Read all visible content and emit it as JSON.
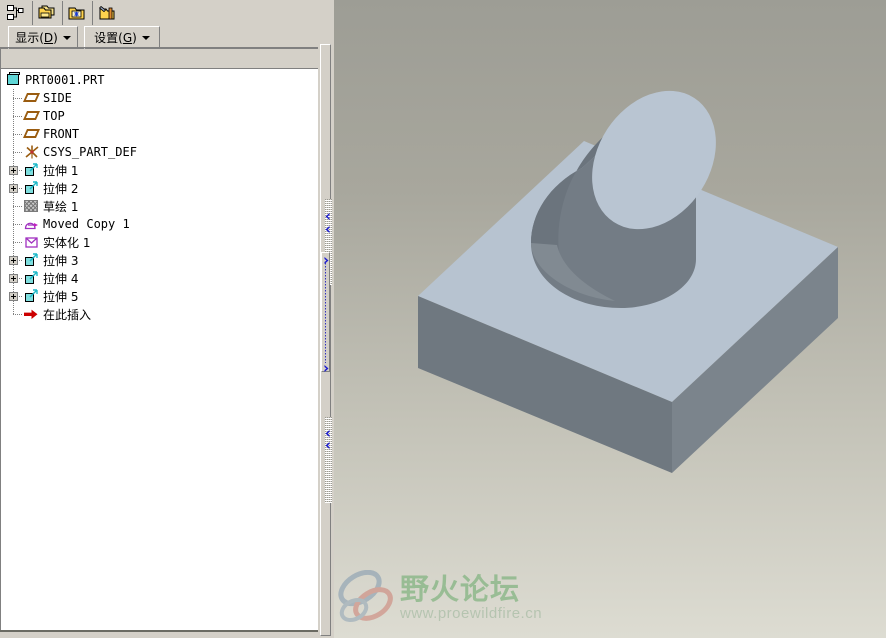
{
  "toolbar": {
    "buttons": [
      {
        "name": "model-tree-icon",
        "tip": "Model Tree"
      },
      {
        "name": "layer-tree-icon",
        "tip": "Layer Tree"
      },
      {
        "name": "new-layer-icon",
        "tip": "New Layer"
      },
      {
        "name": "layer-properties-icon",
        "tip": "Layer Properties"
      }
    ]
  },
  "menubar": {
    "display": {
      "label_pre": "显示(",
      "accel": "D",
      "label_post": ")"
    },
    "settings": {
      "label_pre": "设置(",
      "accel": "G",
      "label_post": ")"
    }
  },
  "tree": {
    "items": [
      {
        "label": "PRT0001.PRT",
        "icon": "part-icon",
        "indent": 0,
        "expander": false,
        "cjk": false
      },
      {
        "label": "SIDE",
        "icon": "datum-plane-icon",
        "indent": 1,
        "expander": false,
        "cjk": false
      },
      {
        "label": "TOP",
        "icon": "datum-plane-icon",
        "indent": 1,
        "expander": false,
        "cjk": false
      },
      {
        "label": "FRONT",
        "icon": "datum-plane-icon",
        "indent": 1,
        "expander": false,
        "cjk": false
      },
      {
        "label": "CSYS_PART_DEF",
        "icon": "coordinate-system-icon",
        "indent": 1,
        "expander": false,
        "cjk": false
      },
      {
        "label": "拉伸 1",
        "icon": "extrude-icon",
        "indent": 1,
        "expander": true,
        "cjk": true
      },
      {
        "label": "拉伸 2",
        "icon": "extrude-icon",
        "indent": 1,
        "expander": true,
        "cjk": true
      },
      {
        "label": "草绘 1",
        "icon": "sketch-icon",
        "indent": 1,
        "expander": false,
        "cjk": true
      },
      {
        "label": "Moved Copy 1",
        "icon": "moved-copy-icon",
        "indent": 1,
        "expander": false,
        "cjk": false
      },
      {
        "label": "实体化 1",
        "icon": "solidify-icon",
        "indent": 1,
        "expander": false,
        "cjk": true
      },
      {
        "label": "拉伸 3",
        "icon": "extrude-icon",
        "indent": 1,
        "expander": true,
        "cjk": true
      },
      {
        "label": "拉伸 4",
        "icon": "extrude-icon",
        "indent": 1,
        "expander": true,
        "cjk": true
      },
      {
        "label": "拉伸 5",
        "icon": "extrude-icon",
        "indent": 1,
        "expander": true,
        "cjk": true
      },
      {
        "label": "在此插入",
        "icon": "insert-here-icon",
        "indent": 1,
        "expander": false,
        "cjk": true
      }
    ]
  },
  "viewport": {
    "model_name": "PRT0001.PRT",
    "shape": "rectangular-block-with-tilted-cylinder",
    "colors": {
      "bg_top": "#9d9d95",
      "bg_bottom": "#dddcd2",
      "face_top": "#b7c3d0",
      "face_front": "#6f7880",
      "face_right": "#7b848c",
      "cylinder_top": "#b9c5d2",
      "cylinder_side": "#737c85"
    }
  },
  "watermark": {
    "cn_text": "野火论坛",
    "url_text": "www.proewildfire.cn"
  }
}
